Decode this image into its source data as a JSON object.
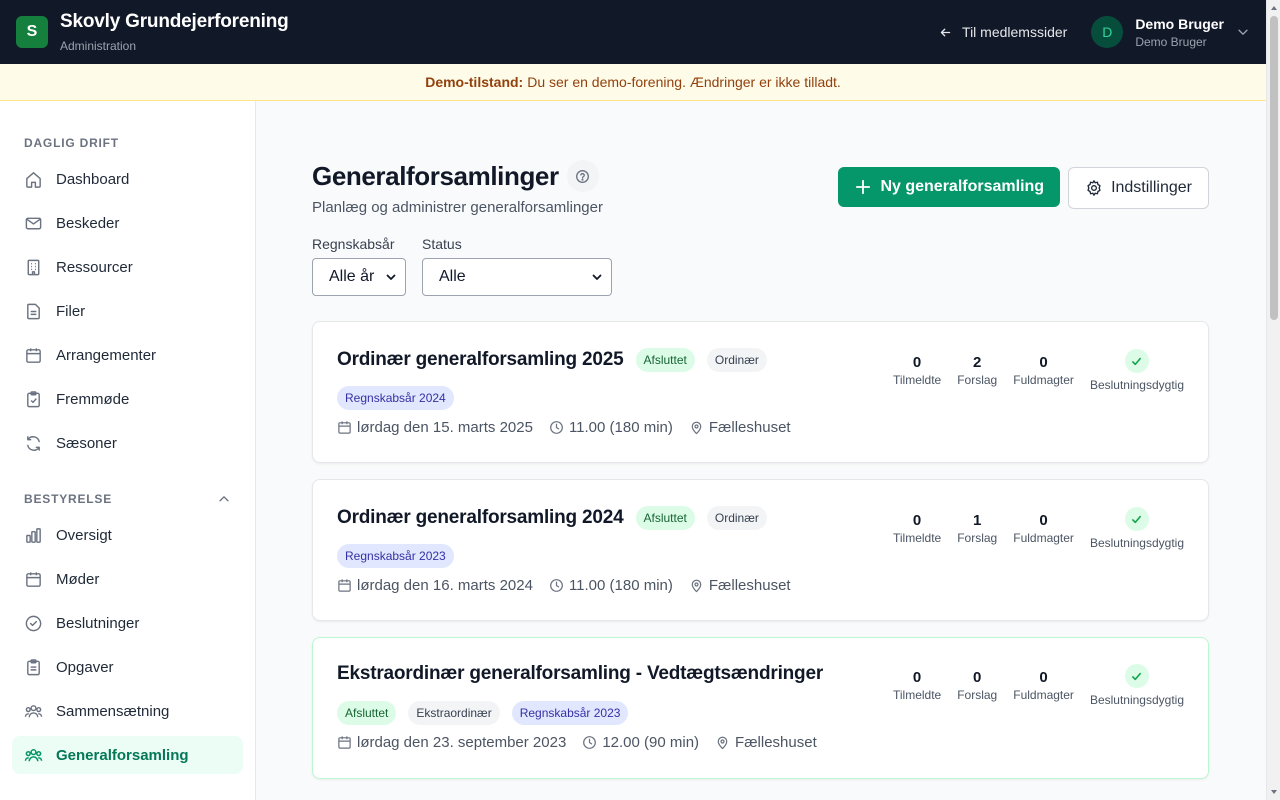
{
  "header": {
    "logo_letter": "S",
    "title": "Skovly Grundejerforening",
    "subtitle": "Administration",
    "back_link": "Til medlemssider",
    "user_initial": "D",
    "user_name": "Demo Bruger",
    "user_role": "Demo Bruger"
  },
  "banner": {
    "label": "Demo-tilstand:",
    "text": "Du ser en demo-forening. Ændringer er ikke tilladt."
  },
  "sidebar": {
    "sections": [
      {
        "title": "DAGLIG DRIFT",
        "items": [
          {
            "label": "Dashboard",
            "icon": "home-icon"
          },
          {
            "label": "Beskeder",
            "icon": "mail-icon"
          },
          {
            "label": "Ressourcer",
            "icon": "building-icon"
          },
          {
            "label": "Filer",
            "icon": "file-icon"
          },
          {
            "label": "Arrangementer",
            "icon": "calendar-icon"
          },
          {
            "label": "Fremmøde",
            "icon": "clipboard-check-icon"
          },
          {
            "label": "Sæsoner",
            "icon": "refresh-icon"
          }
        ]
      },
      {
        "title": "BESTYRELSE",
        "items": [
          {
            "label": "Oversigt",
            "icon": "bar-chart-icon"
          },
          {
            "label": "Møder",
            "icon": "calendar-icon"
          },
          {
            "label": "Beslutninger",
            "icon": "check-circle-icon"
          },
          {
            "label": "Opgaver",
            "icon": "clipboard-icon"
          },
          {
            "label": "Sammensætning",
            "icon": "users-icon"
          },
          {
            "label": "Generalforsamling",
            "icon": "users-group-icon",
            "active": true
          }
        ]
      }
    ]
  },
  "page": {
    "title": "Generalforsamlinger",
    "subtitle": "Planlæg og administrer generalforsamlinger",
    "new_button": "Ny generalforsamling",
    "settings_button": "Indstillinger"
  },
  "filters": {
    "year_label": "Regnskabsår",
    "year_value": "Alle år",
    "status_label": "Status",
    "status_value": "Alle"
  },
  "stat_labels": {
    "registered": "Tilmeldte",
    "proposals": "Forslag",
    "proxies": "Fuldmagter",
    "quorum": "Beslutningsdygtig"
  },
  "assemblies": [
    {
      "title": "Ordinær generalforsamling 2025",
      "status": "Afsluttet",
      "type": "Ordinær",
      "fiscal_year": "Regnskabsår 2024",
      "date": "lørdag den 15. marts 2025",
      "time": "11.00 (180 min)",
      "location": "Fælleshuset",
      "registered": "0",
      "proposals": "2",
      "proxies": "0"
    },
    {
      "title": "Ordinær generalforsamling 2024",
      "status": "Afsluttet",
      "type": "Ordinær",
      "fiscal_year": "Regnskabsår 2023",
      "date": "lørdag den 16. marts 2024",
      "time": "11.00 (180 min)",
      "location": "Fælleshuset",
      "registered": "0",
      "proposals": "1",
      "proxies": "0"
    },
    {
      "title": "Ekstraordinær generalforsamling - Vedtægtsændringer",
      "status": "Afsluttet",
      "type": "Ekstraordinær",
      "fiscal_year": "Regnskabsår 2023",
      "date": "lørdag den 23. september 2023",
      "time": "12.00 (90 min)",
      "location": "Fælleshuset",
      "registered": "0",
      "proposals": "0",
      "proxies": "0"
    }
  ],
  "colors": {
    "topbar": "#111827",
    "accent": "#059669",
    "banner_bg": "#fefce8"
  }
}
